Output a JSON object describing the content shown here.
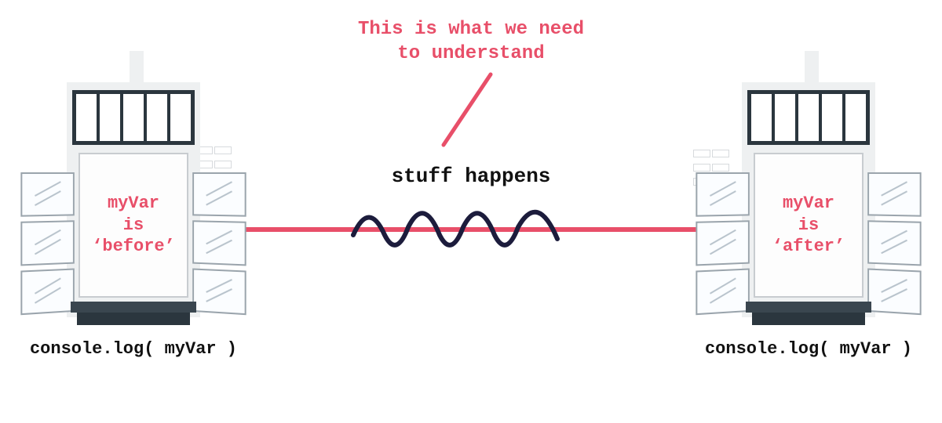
{
  "annotation": {
    "line1": "This is what we need",
    "line2": "to understand"
  },
  "center": {
    "label": "stuff happens"
  },
  "left": {
    "state_line1": "myVar",
    "state_line2": "is",
    "state_line3": "‘before’",
    "caption": "console.log( myVar )"
  },
  "right": {
    "state_line1": "myVar",
    "state_line2": "is",
    "state_line3": "‘after’",
    "caption": "console.log( myVar )"
  },
  "colors": {
    "accent": "#e84f69",
    "ink": "#1c1c3c"
  }
}
